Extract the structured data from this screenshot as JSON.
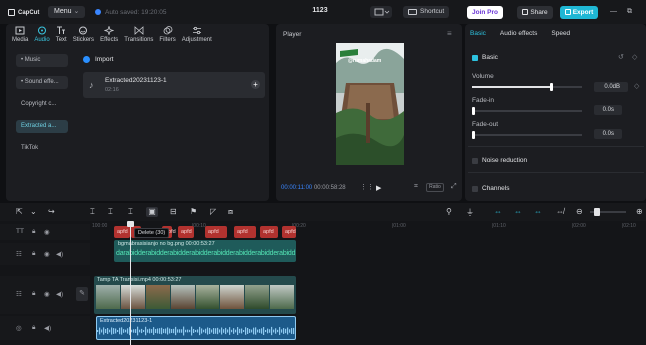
{
  "app": {
    "logo": "CapCut",
    "menu_label": "Menu",
    "autosave": "Auto saved: 19:20:05",
    "project_title": "1123",
    "shortcut_label": "Shortcut",
    "joinpro_label": "Join Pro",
    "share_label": "Share",
    "export_label": "Export"
  },
  "categories": [
    {
      "label": "Media",
      "icon": "media-icon",
      "active": false
    },
    {
      "label": "Audio",
      "icon": "audio-icon",
      "active": true
    },
    {
      "label": "Text",
      "icon": "text-icon",
      "active": false
    },
    {
      "label": "Stickers",
      "icon": "stickers-icon",
      "active": false
    },
    {
      "label": "Effects",
      "icon": "effects-icon",
      "active": false
    },
    {
      "label": "Transitions",
      "icon": "transitions-icon",
      "active": false
    },
    {
      "label": "Filters",
      "icon": "filters-icon",
      "active": false
    },
    {
      "label": "Adjustment",
      "icon": "adjustment-icon",
      "active": false
    }
  ],
  "sidebar": {
    "items": [
      {
        "label": "• Music"
      },
      {
        "label": "• Sound effe..."
      },
      {
        "label": "Copyright c..."
      },
      {
        "label": "Extracted a..."
      },
      {
        "label": "TikTok"
      }
    ]
  },
  "media": {
    "import_label": "Import",
    "item_name": "Extracted20231123-1",
    "item_duration": "02:16"
  },
  "player": {
    "title": "Player",
    "current_time": "00:00:11:00",
    "total_time": "00:00:58:28",
    "ratio_label": "Ratio",
    "watermark": "@rumahadam"
  },
  "right_panel": {
    "tabs": [
      "Basic",
      "Audio effects",
      "Speed"
    ],
    "basic_section": "Basic",
    "volume_label": "Volume",
    "volume_value": "0.0dB",
    "volume_level": 0.72,
    "fadein_label": "Fade-in",
    "fadein_value": "0.0s",
    "fadeout_label": "Fade-out",
    "fadeout_value": "0.0s",
    "noise_label": "Noise reduction",
    "channels_label": "Channels"
  },
  "timeline": {
    "ruler": [
      "100:00",
      "|00:10",
      "|00:20",
      "|01:00",
      "|01:10",
      "|02:00",
      "|02:10"
    ],
    "text_clips": [
      "apfd",
      "apfd",
      "apfd",
      "apfd",
      "apfd",
      "apfd",
      "apfd",
      "apfd"
    ],
    "tooltip": "Delete (30)",
    "sticker_clip_title": "bgmabrasisianjo no bg.png  00:00:53:27",
    "sticker_clip_text": "darabidderabidderabidderabidderabidderabidderabidderabidd",
    "video_clip_title": "Tamp  TA Transisi.mp4  00:00:53:27",
    "audio_clip_title": "Extracted20231123-1"
  }
}
